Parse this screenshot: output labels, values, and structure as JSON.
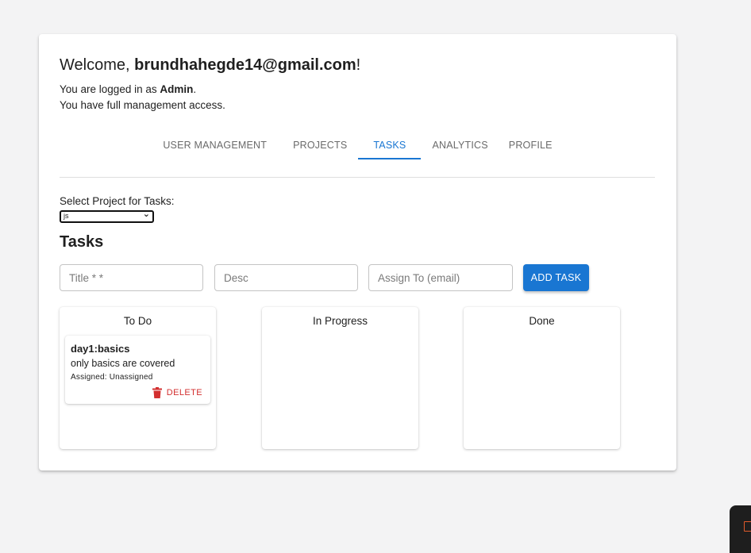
{
  "header": {
    "welcome_prefix": "Welcome, ",
    "user_email": "brundhahegde14@gmail.com",
    "welcome_suffix": "!",
    "role_prefix": "You are logged in as ",
    "role": "Admin",
    "role_suffix": ".",
    "access_text": "You have full management access."
  },
  "tabs": [
    {
      "label": "USER MANAGEMENT",
      "active": false
    },
    {
      "label": "PROJECTS",
      "active": false
    },
    {
      "label": "TASKS",
      "active": true
    },
    {
      "label": "ANALYTICS",
      "active": false
    },
    {
      "label": "PROFILE",
      "active": false
    }
  ],
  "project_select": {
    "label": "Select Project for Tasks:",
    "value": "js"
  },
  "tasks_section": {
    "heading": "Tasks",
    "title_placeholder": "Title * *",
    "desc_placeholder": "Desc",
    "assign_placeholder": "Assign To (email)",
    "add_button": "ADD TASK"
  },
  "columns": [
    {
      "title": "To Do",
      "tasks": [
        {
          "title": "day1:basics",
          "description": "only basics are covered",
          "assigned": "Assigned: Unassigned",
          "delete_label": "DELETE"
        }
      ]
    },
    {
      "title": "In Progress",
      "tasks": []
    },
    {
      "title": "Done",
      "tasks": []
    }
  ],
  "colors": {
    "accent": "#1976d2",
    "danger": "#d32f2f",
    "background": "#f3f3f4"
  }
}
